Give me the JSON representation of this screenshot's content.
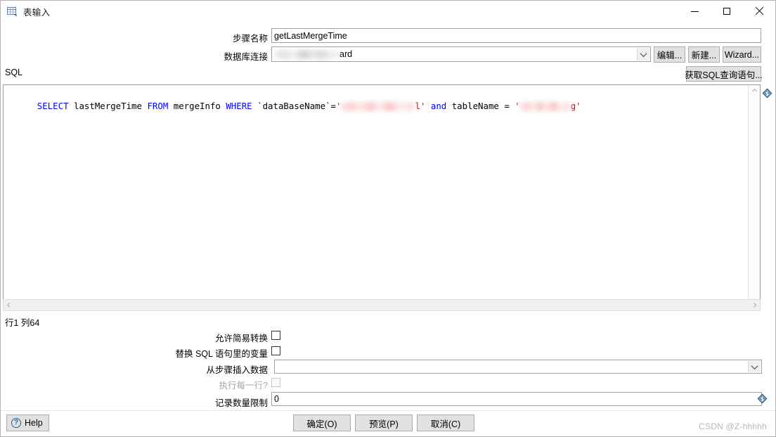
{
  "window": {
    "title": "表输入",
    "icon": "table-input-icon",
    "controls": {
      "minimize": "minimize-icon",
      "maximize": "maximize-icon",
      "close": "close-icon"
    }
  },
  "form": {
    "step_name_label": "步骤名称",
    "step_name_value": "getLastMergeTime",
    "connection_label": "数据库连接",
    "connection_value_suffix": "ard",
    "connection_value_redacted": true,
    "edit_button": "编辑...",
    "new_button": "新建...",
    "wizard_button": "Wizard...",
    "get_sql_button": "获取SQL查询语句..."
  },
  "sql": {
    "section_label": "SQL",
    "tokens": [
      {
        "text": "SELECT",
        "kind": "keyword"
      },
      {
        "text": " lastMergeTime ",
        "kind": "plain"
      },
      {
        "text": "FROM",
        "kind": "keyword"
      },
      {
        "text": " mergeInfo ",
        "kind": "plain"
      },
      {
        "text": "WHERE",
        "kind": "keyword"
      },
      {
        "text": " `dataBaseName`=",
        "kind": "plain"
      },
      {
        "text": "'",
        "kind": "string"
      },
      {
        "text": "",
        "kind": "redacted-red",
        "width": 105
      },
      {
        "text": "l'",
        "kind": "string"
      },
      {
        "text": " ",
        "kind": "plain"
      },
      {
        "text": "and",
        "kind": "keyword"
      },
      {
        "text": " tableName = ",
        "kind": "plain"
      },
      {
        "text": "'",
        "kind": "string"
      },
      {
        "text": "",
        "kind": "redacted-red",
        "width": 72
      },
      {
        "text": "g'",
        "kind": "string"
      }
    ],
    "plain_text": "SELECT lastMergeTime FROM mergeInfo WHERE `dataBaseName`='****l' and tableName = '****g'",
    "caret_status": "行1 列64",
    "variable_marker": "$"
  },
  "options": {
    "lazy_conversion_label": "允许简易转换",
    "lazy_conversion_checked": false,
    "replace_variables_label": "替换 SQL 语句里的变量",
    "replace_variables_checked": false,
    "insert_data_from_step_label": "从步骤插入数据",
    "insert_data_from_step_value": "",
    "execute_each_row_label": "执行每一行?",
    "execute_each_row_checked": false,
    "execute_each_row_disabled": true,
    "limit_size_label": "记录数量限制",
    "limit_size_value": "0"
  },
  "footer": {
    "help_label": "Help",
    "ok_button": "确定(O)",
    "ok_mnemonic": "O",
    "preview_button": "预览(P)",
    "preview_mnemonic": "P",
    "cancel_button": "取消(C)",
    "cancel_mnemonic": "C",
    "watermark": "CSDN @Z-hhhhh"
  },
  "colors": {
    "keyword": "#0000ff",
    "string": "#e00000",
    "plain": "#000000",
    "button_face": "#e1e1e1",
    "variable_marker": "#2f5f86"
  }
}
